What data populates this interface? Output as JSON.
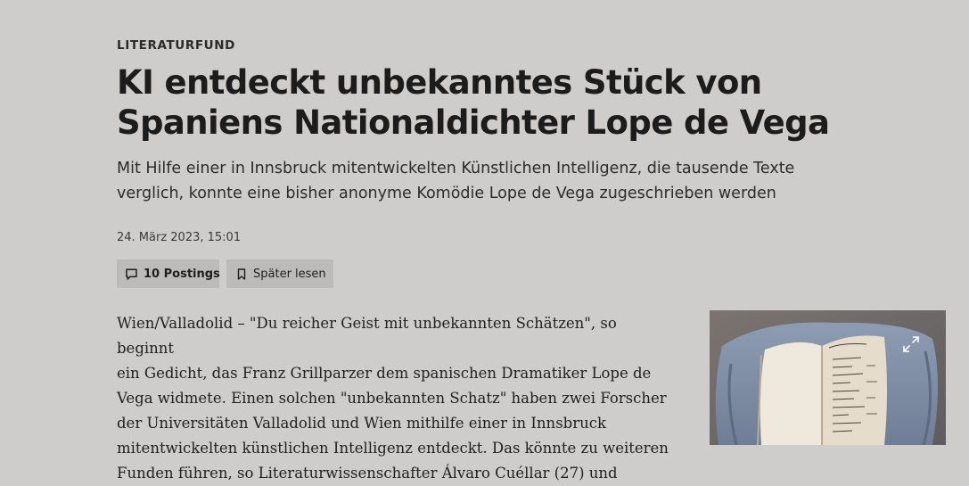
{
  "article": {
    "kicker": "LITERATURFUND",
    "title_line1": "KI entdeckt unbekanntes Stück von",
    "title_line2": "Spaniens Nationaldichter Lope de Vega",
    "subtitle": "Mit Hilfe einer in Innsbruck mitentwickelten Künstlichen Intelligenz, die tausende Texte verglich, konnte eine bisher anonyme Komödie Lope de Vega zugeschrieben werden",
    "date": "24. März 2023, 15:01",
    "body_lines": [
      "Wien/Valladolid – \"Du reicher Geist mit unbekannten Schätzen\", so beginnt",
      "ein Gedicht, das Franz Grillparzer dem spanischen Dramatiker Lope de",
      "Vega widmete. Einen solchen \"unbekannten Schatz\" haben zwei Forscher",
      "der Universitäten Valladolid und Wien mithilfe einer in Innsbruck",
      "mitentwickelten künstlichen Intelligenz entdeckt. Das könnte zu weiteren",
      "Funden führen, so Literaturwissenschafter Álvaro Cuéllar (27) und"
    ]
  },
  "actions": {
    "postings_label": "10 Postings",
    "later_label": "Später lesen"
  },
  "icons": {
    "postings": "speech-bubble-icon",
    "later": "bookmark-icon",
    "expand": "expand-arrows-icon"
  },
  "colors": {
    "background": "#cfcdcc",
    "button_bg": "#bdbbba",
    "text": "#1d1d1d"
  }
}
